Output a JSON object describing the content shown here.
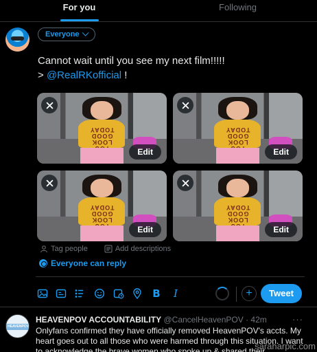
{
  "tabs": [
    {
      "label": "For you",
      "active": true
    },
    {
      "label": "Following",
      "active": false
    }
  ],
  "composer": {
    "audience_label": "Everyone",
    "text_line1": "Cannot wait until you see my next film!!!!!",
    "text_prefix": "> ",
    "mention": "@RealRKofficial",
    "text_suffix": " !",
    "media": [
      {
        "shirt_text": "YOU LOOK GOOD TODAY",
        "edit_label": "Edit"
      },
      {
        "shirt_text": "YOU LOOK GOOD TODAY",
        "edit_label": "Edit"
      },
      {
        "shirt_text": "YOU LOOK GOOD TODAY",
        "edit_label": "Edit"
      },
      {
        "shirt_text": "YOU LOOK GOOD TODAY",
        "edit_label": "Edit"
      }
    ],
    "tag_people": "Tag people",
    "add_descriptions": "Add descriptions",
    "reply_setting": "Everyone can reply",
    "toolbar_icons": [
      "image-icon",
      "gif-icon",
      "poll-icon",
      "emoji-icon",
      "schedule-icon",
      "location-icon",
      "bold-icon",
      "italic-icon"
    ],
    "bold_glyph": "B",
    "italic_glyph": "I",
    "add_glyph": "+",
    "tweet_button": "Tweet"
  },
  "post": {
    "avatar_label": "HEAVENPOV",
    "name": "HEAVENPOV ACCOUNTABILITY",
    "handle": "@CancelHeavenPOV",
    "time": "· 42m",
    "more": "···",
    "body": "Onlyfans confirmed they have officially removed HeavenPOV's accts. My heart goes out to all those who were harmed through this situation. I want to acknowledge the brave women who spoke up & shared their experiences"
  },
  "watermark": "saraharpic.com",
  "colors": {
    "accent": "#1d9bf0",
    "background": "#000000",
    "text": "#e7e9ea",
    "muted": "#71767b"
  }
}
